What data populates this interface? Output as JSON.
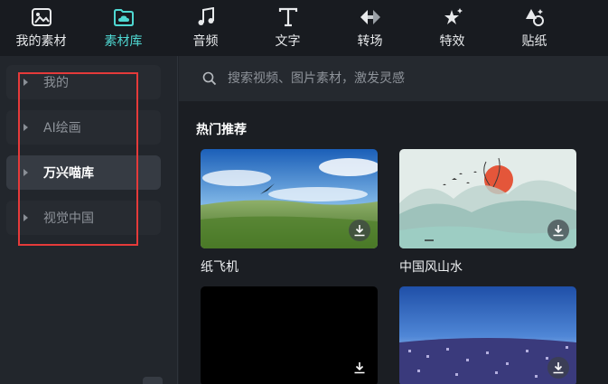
{
  "tabs": [
    {
      "label": "我的素材",
      "icon": "my-assets-icon",
      "active": false
    },
    {
      "label": "素材库",
      "icon": "cloud-folder-icon",
      "active": true
    },
    {
      "label": "音频",
      "icon": "music-note-icon",
      "active": false
    },
    {
      "label": "文字",
      "icon": "text-icon",
      "active": false
    },
    {
      "label": "转场",
      "icon": "transition-icon",
      "active": false
    },
    {
      "label": "特效",
      "icon": "effects-star-icon",
      "active": false
    },
    {
      "label": "贴纸",
      "icon": "sticker-icon",
      "active": false
    }
  ],
  "colors": {
    "accent": "#4fd8d2",
    "highlight_box": "#e53a3a"
  },
  "sidebar": {
    "items": [
      {
        "label": "我的",
        "active": false
      },
      {
        "label": "AI绘画",
        "active": false
      },
      {
        "label": "万兴喵库",
        "active": true
      },
      {
        "label": "视觉中国",
        "active": false
      }
    ]
  },
  "search": {
    "placeholder": "搜索视频、图片素材，激发灵感"
  },
  "section": {
    "title": "热门推荐"
  },
  "cards": [
    {
      "name": "纸飞机",
      "thumb": "sky-grassland"
    },
    {
      "name": "中国风山水",
      "thumb": "ink-landscape"
    },
    {
      "name": "",
      "thumb": "black"
    },
    {
      "name": "",
      "thumb": "city-night"
    }
  ]
}
